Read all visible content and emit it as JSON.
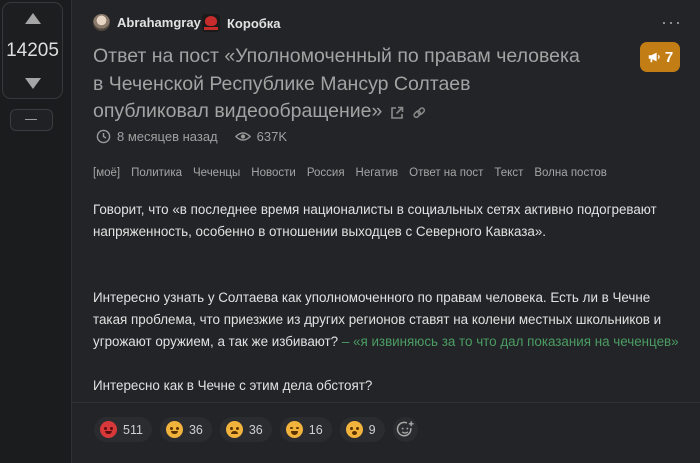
{
  "vote": {
    "rating": "14205"
  },
  "post": {
    "author": "Abrahamgray",
    "community": "Коробка",
    "badge_count": "7",
    "title": "Ответ на пост «Уполномоченный по правам человека в Чеченской Республике Мансур Солтаев опубликовал видеообращение»",
    "time_ago": "8 месяцев назад",
    "views": "637K",
    "tags": [
      "[моё]",
      "Политика",
      "Чеченцы",
      "Новости",
      "Россия",
      "Негатив",
      "Ответ на пост",
      "Текст",
      "Волна постов"
    ],
    "paragraph1": "Говорит, что «в последнее время националисты в социальных сетях активно подогревают напряженность, особенно в отношении выходцев с Северного Кавказа».",
    "paragraph2": "Интересно узнать у Солтаева как уполномоченного по правам человека. Есть ли в Чечне такая проблема, что приезжие из других регионов ставят на колени местных школьников и угрожают оружием, а так же избивают?",
    "quote_link": "– «я извиняюсь за то что дал показания на чеченцев»",
    "paragraph3": "Интересно как в Чечне с этим дела обстоят?"
  },
  "reactions": [
    {
      "icon": "angry-emoji-icon",
      "count": "511"
    },
    {
      "icon": "happy-emoji-icon",
      "count": "36"
    },
    {
      "icon": "sad-emoji-icon",
      "count": "36"
    },
    {
      "icon": "laughing-emoji-icon",
      "count": "16"
    },
    {
      "icon": "scared-emoji-icon",
      "count": "9"
    }
  ],
  "colors": {
    "badge": "#c27d15",
    "quote": "#4a9d63",
    "background": "#1b1c1e",
    "card": "#232427"
  }
}
